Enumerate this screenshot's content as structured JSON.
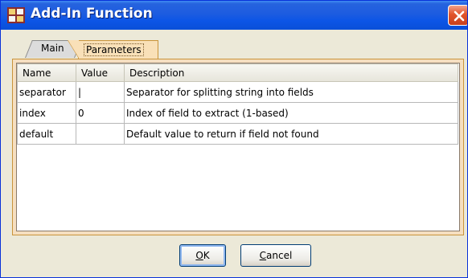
{
  "window": {
    "title": "Add-In Function",
    "icon": "addin-function-icon"
  },
  "tabs": [
    {
      "label": "Main",
      "selected": false
    },
    {
      "label": "Parameters",
      "selected": true
    }
  ],
  "table": {
    "headers": [
      "Name",
      "Value",
      "Description"
    ],
    "rows": [
      {
        "name": "separator",
        "value": "|",
        "description": "Separator for splitting string into fields"
      },
      {
        "name": "index",
        "value": "0",
        "description": "Index of field to extract (1-based)"
      },
      {
        "name": "default",
        "value": "",
        "description": "Default value to return if field not found"
      }
    ]
  },
  "buttons": {
    "ok_mnemonic": "O",
    "ok_rest": "K",
    "cancel_mnemonic": "C",
    "cancel_rest": "ancel"
  },
  "colors": {
    "titlebar": "#0c55e6",
    "tab_active": "#f9e0b8",
    "panel_border": "#c9943b"
  }
}
